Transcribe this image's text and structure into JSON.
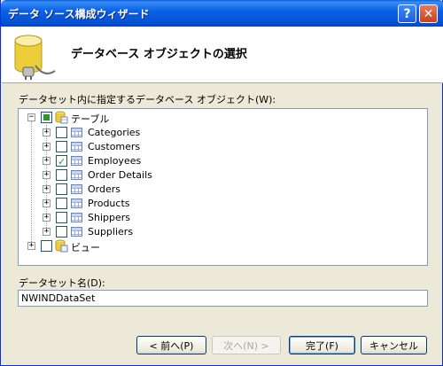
{
  "window": {
    "title": "データ ソース構成ウィザード",
    "help_label": "?",
    "close_label": "✕"
  },
  "header": {
    "title": "データベース オブジェクトの選択"
  },
  "tree": {
    "label": "データセット内に指定するデータベース オブジェクト(W):",
    "tables": {
      "label": "テーブル",
      "state": "partial",
      "expander": "−",
      "items": [
        {
          "label": "Categories",
          "checked": false
        },
        {
          "label": "Customers",
          "checked": false
        },
        {
          "label": "Employees",
          "checked": true
        },
        {
          "label": "Order Details",
          "checked": false
        },
        {
          "label": "Orders",
          "checked": false
        },
        {
          "label": "Products",
          "checked": false
        },
        {
          "label": "Shippers",
          "checked": false
        },
        {
          "label": "Suppliers",
          "checked": false
        }
      ]
    },
    "views": {
      "label": "ビュー",
      "state": "unchecked",
      "expander": "+"
    }
  },
  "dataset": {
    "label": "データセット名(D):",
    "value": "NWINDDataSet"
  },
  "buttons": {
    "back": "< 前へ(P)",
    "next": "次へ(N) >",
    "finish": "完了(F)",
    "cancel": "キャンセル"
  },
  "colors": {
    "titlebar": "#0a62e6",
    "check_green": "#21a121",
    "face": "#ece9d8"
  }
}
